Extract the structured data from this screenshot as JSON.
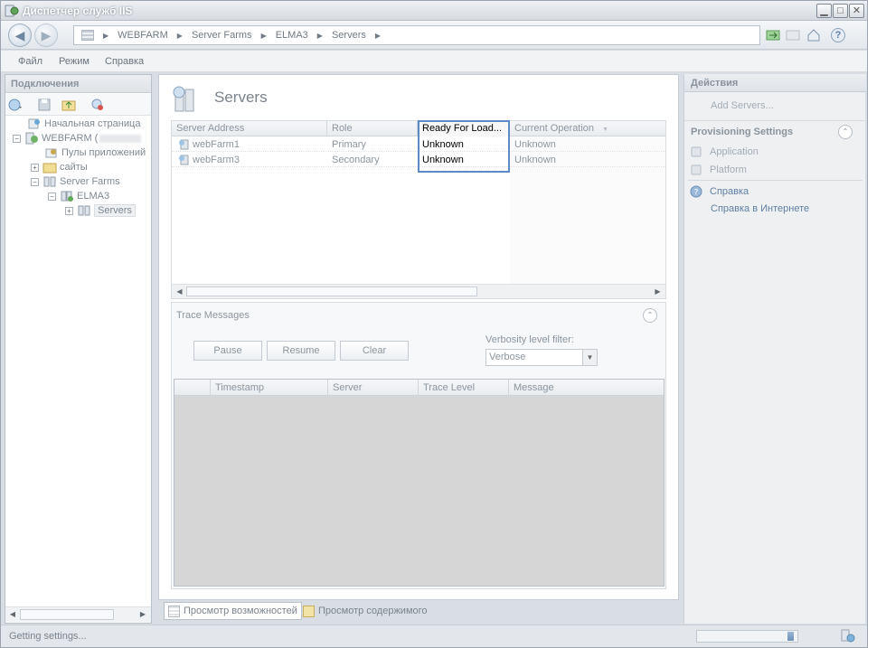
{
  "window": {
    "title": "Диспетчер служб IIS",
    "minimize": "▁",
    "maximize": "□",
    "close": "✕"
  },
  "nav": {
    "back_glyph": "◀",
    "forward_glyph": "▶",
    "breadcrumbs": [
      "WEBFARM",
      "Server Farms",
      "ELMA3",
      "Servers"
    ],
    "separator": "▶",
    "help_glyph": "?"
  },
  "menu": [
    "Файл",
    "Режим",
    "Справка"
  ],
  "connections": {
    "title": "Подключения",
    "tree": [
      {
        "label": "Начальная страница",
        "icon": "start-page-icon"
      },
      {
        "label": "WEBFARM (",
        "icon": "server-icon",
        "expander": "−"
      },
      {
        "label": "Пулы приложений",
        "icon": "app-pools-icon"
      },
      {
        "label": "сайты",
        "icon": "sites-icon",
        "expander": "+"
      },
      {
        "label": "Server Farms",
        "icon": "server-farms-icon",
        "expander": "−"
      },
      {
        "label": "ELMA3",
        "icon": "farm-icon",
        "expander": "−"
      },
      {
        "label": "Servers",
        "icon": "servers-icon",
        "expander": "+"
      }
    ],
    "scroll_left": "◀",
    "scroll_right": "▶"
  },
  "main": {
    "title": "Servers",
    "columns": [
      "Server Address",
      "Role",
      "Ready For Load...",
      "Current Operation"
    ],
    "sort_glyph": "▼",
    "rows": [
      {
        "address": "webFarm1",
        "role": "Primary",
        "ready": "Unknown",
        "operation": "Unknown"
      },
      {
        "address": "webFarm3",
        "role": "Secondary",
        "ready": "Unknown",
        "operation": "Unknown"
      }
    ],
    "scroll_left": "◀",
    "scroll_right": "▶"
  },
  "trace": {
    "title": "Trace Messages",
    "collapse_glyph": "⌃",
    "buttons": {
      "pause": "Pause",
      "resume": "Resume",
      "clear": "Clear"
    },
    "verbosity_label": "Verbosity level filter:",
    "verbosity_value": "Verbose",
    "dropdown_glyph": "▼",
    "columns": [
      "Timestamp",
      "Server",
      "Trace Level",
      "Message"
    ]
  },
  "tabs": {
    "features": "Просмотр возможностей",
    "content": "Просмотр содержимого"
  },
  "actions": {
    "title": "Действия",
    "add_servers": "Add Servers...",
    "provisioning_title": "Provisioning Settings",
    "collapse_glyph": "⌃",
    "application": "Application",
    "platform": "Platform",
    "help": "Справка",
    "online_help": "Справка в Интернете"
  },
  "status": {
    "text": "Getting settings...",
    "progress": 0.06
  },
  "colors": {
    "accent": "#5b8bc4",
    "link": "#5e7fa4"
  }
}
